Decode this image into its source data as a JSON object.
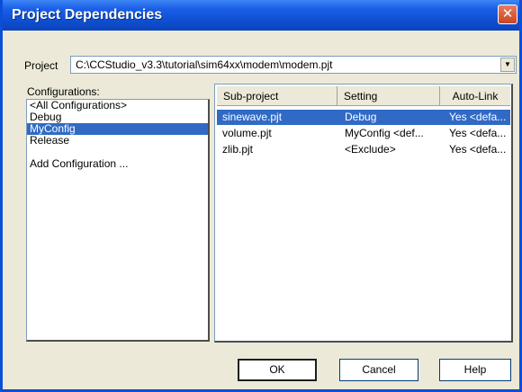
{
  "window": {
    "title": "Project Dependencies",
    "close_symbol": "✕"
  },
  "project": {
    "label": "Project",
    "value": "C:\\CCStudio_v3.3\\tutorial\\sim64xx\\modem\\modem.pjt",
    "arrow_symbol": "▼"
  },
  "configurations": {
    "heading": "Configurations:",
    "items": [
      {
        "label": "<All Configurations>",
        "selected": false
      },
      {
        "label": "Debug",
        "selected": false
      },
      {
        "label": "MyConfig",
        "selected": true
      },
      {
        "label": "Release",
        "selected": false
      }
    ],
    "add_label": "Add Configuration ..."
  },
  "grid": {
    "headers": {
      "sub_project": "Sub-project",
      "setting": "Setting",
      "auto_link": "Auto-Link"
    },
    "rows": [
      {
        "sub_project": "sinewave.pjt",
        "setting": "Debug",
        "auto_link": "Yes <defa...",
        "selected": true
      },
      {
        "sub_project": "volume.pjt",
        "setting": "MyConfig  <def...",
        "auto_link": "Yes <defa...",
        "selected": false
      },
      {
        "sub_project": "zlib.pjt",
        "setting": "<Exclude>",
        "auto_link": "Yes <defa...",
        "selected": false
      }
    ]
  },
  "buttons": {
    "ok": "OK",
    "cancel": "Cancel",
    "help": "Help"
  }
}
